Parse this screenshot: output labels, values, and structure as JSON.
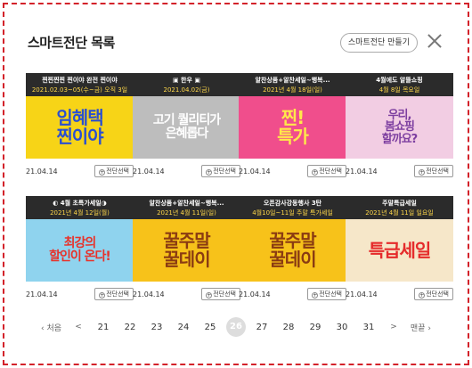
{
  "header": {
    "title": "스마트전단 목록",
    "make_button": "스마트전단 만들기"
  },
  "cards": [
    {
      "line1": "찐찐찐찐 찐이야 완전 찐이야",
      "line2": "2021.02.03~05(수~금) 오직 3일",
      "thumb_text": "임혜택\n찐이야",
      "date": "21.04.14",
      "button": "전단선택",
      "bg": "#f7d417",
      "fg": "#2a4fd1"
    },
    {
      "line1": "▣ 한우 ▣",
      "line2": "2021.04.02(금)",
      "thumb_text": "고기 퀄리티가\n은혜롭다",
      "date": "21.04.14",
      "button": "전단선택",
      "bg": "#bdbdbd",
      "fg": "#ffffff"
    },
    {
      "line1": "알찬상품+알찬세일~행복...",
      "line2": "2021년 4월 18일(일)",
      "thumb_text": "찐!\n특가",
      "date": "21.04.14",
      "button": "전단선택",
      "bg": "#f04e8c",
      "fg": "#ffe84a"
    },
    {
      "line1": "4월에도 알뜰쇼핑",
      "line2": "4월 8일 목요일",
      "thumb_text": "우리,\n봄쇼핑\n할까요?",
      "date": "21.04.14",
      "button": "전단선택",
      "bg": "#f2cde3",
      "fg": "#7d3fa0"
    },
    {
      "line1": "◐ 4월 초특가세일◑",
      "line2": "2021년 4월 12일(월)",
      "thumb_text": "최강의\n할인이 온다!",
      "date": "21.04.14",
      "button": "전단선택",
      "bg": "#8fd3ee",
      "fg": "#e8322a"
    },
    {
      "line1": "알찬상품+알찬세일~행복...",
      "line2": "2021년 4월 11일(일)",
      "thumb_text": "꿀주말\n꿀데이",
      "date": "21.04.14",
      "button": "전단선택",
      "bg": "#f7c21a",
      "fg": "#8a3b12"
    },
    {
      "line1": "오픈감사강동행사 3탄",
      "line2": "4월10일~11일 주말 특가세일",
      "thumb_text": "꿀주말\n꿀데이",
      "date": "21.04.14",
      "button": "전단선택",
      "bg": "#f7c21a",
      "fg": "#8a3b12"
    },
    {
      "line1": "주말특급세일",
      "line2": "2021년 4월 11일 일요일",
      "thumb_text": "특급세일",
      "date": "21.04.14",
      "button": "전단선택",
      "bg": "#f6e7c9",
      "fg": "#e52b2b"
    }
  ],
  "pager": {
    "first": "‹ 처음",
    "prev": "<",
    "pages": [
      "21",
      "22",
      "23",
      "24",
      "25",
      "26",
      "27",
      "28",
      "29",
      "30",
      "31"
    ],
    "current": "26",
    "next": ">",
    "last": "맨끝 ›"
  }
}
